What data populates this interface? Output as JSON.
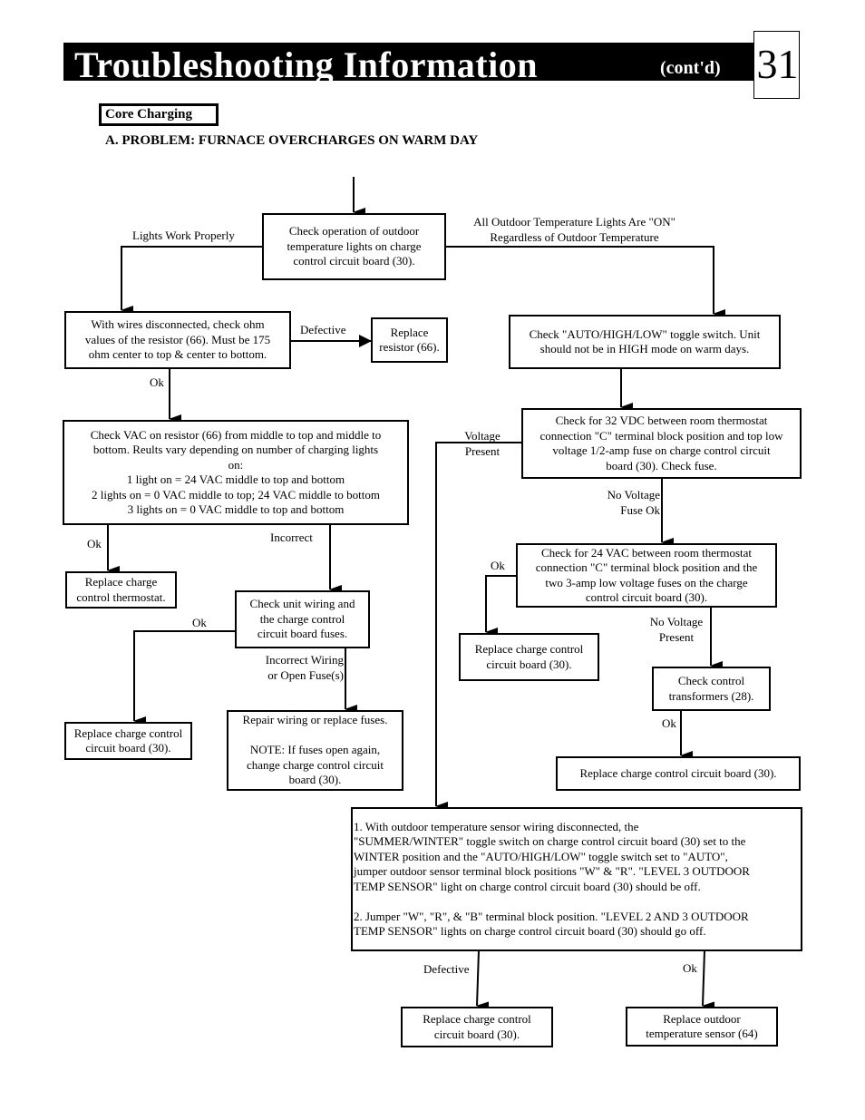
{
  "header": {
    "title": "Troubleshooting  Information",
    "subtitle": "(cont'd)",
    "page_number": "31"
  },
  "section": "Core  Charging",
  "problem": "A.  PROBLEM:  FURNACE OVERCHARGES ON WARM DAY",
  "nodes": {
    "check_lights": "Check operation of outdoor\ntemperature lights on charge\ncontrol circuit board (30).",
    "check_ohm": "With wires disconnected, check ohm\nvalues of the resistor (66).  Must be 175\nohm center to top & center to bottom.",
    "replace_resistor": "Replace\nresistor (66).",
    "check_toggle": "Check \"AUTO/HIGH/LOW\" toggle switch.  Unit\nshould not be in HIGH mode on warm days.",
    "check_vac_resistor": "Check VAC on resistor (66) from middle to top and middle to\nbottom. Reults vary depending on number of charging lights\non:\n1 light on = 24 VAC middle to top and bottom\n2 lights on = 0 VAC middle to top; 24 VAC middle to bottom\n3 lights on = 0 VAC middle to top and bottom",
    "check_32vdc": "Check for 32 VDC between room thermostat\nconnection \"C\" terminal block position and top low\nvoltage 1/2-amp fuse on charge control circuit\nboard (30).  Check fuse.",
    "replace_thermostat": "Replace charge\ncontrol  thermostat.",
    "check_wiring": "Check unit wiring and\nthe charge control\ncircuit board fuses.",
    "check_24vac": "Check for 24 VAC between room thermostat\nconnection \"C\" terminal block position and the\ntwo 3-amp low voltage fuses on the charge\ncontrol circuit board (30).",
    "replace_board_a": "Replace charge control\ncircuit board (30).",
    "replace_board_b": "Replace charge control\ncircuit board (30).",
    "check_transformers": "Check control\ntransformers (28).",
    "repair_wiring": "Repair wiring or replace fuses.\n\nNOTE: If fuses open again,\nchange charge control circuit\nboard (30).",
    "replace_board_c": "Replace charge control circuit board (30).",
    "sensor_test": "1.   With outdoor temperature sensor wiring disconnected, the\n\"SUMMER/WINTER\" toggle switch on charge control circuit board (30) set to the\nWINTER position and the \"AUTO/HIGH/LOW\" toggle switch set to \"AUTO\",\njumper outdoor sensor terminal block positions \"W\" & \"R\".  \"LEVEL 3 OUTDOOR\nTEMP SENSOR\" light on charge control circuit board (30) should be off.\n\n2.   Jumper \"W\", \"R\", & \"B\" terminal block position. \"LEVEL 2 AND 3 OUTDOOR\nTEMP  SENSOR\" lights on charge control circuit board (30) should go off.",
    "replace_board_d": "Replace charge control\ncircuit board (30).",
    "replace_sensor": "Replace outdoor\ntemperature sensor (64)"
  },
  "labels": {
    "lights_work": "Lights Work Properly",
    "all_lights_on": "All Outdoor Temperature Lights Are \"ON\"\nRegardless of Outdoor Temperature",
    "defective_1": "Defective",
    "ok_1": "Ok",
    "voltage_present": "Voltage\nPresent",
    "no_voltage_fuse_ok": "No Voltage\nFuse Ok",
    "ok_2": "Ok",
    "incorrect": "Incorrect",
    "ok_3": "Ok",
    "ok_4": "Ok",
    "no_voltage_present": "No Voltage\nPresent",
    "incorrect_wiring": "Incorrect Wiring\nor Open Fuse(s)",
    "ok_5": "Ok",
    "defective_2": "Defective",
    "ok_6": "Ok"
  }
}
